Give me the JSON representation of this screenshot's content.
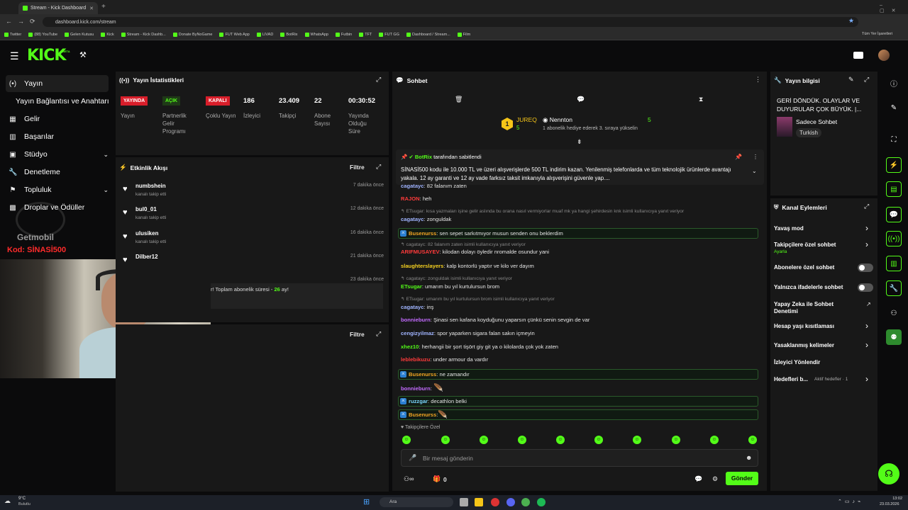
{
  "browser": {
    "tab_title": "Stream - Kick Dashboard",
    "url": "dashboard.kick.com/stream",
    "bookmarks": [
      "Twitter",
      "(88) YouTube",
      "Gelen Kutusu",
      "Kick",
      "Stream - Kick Dashb...",
      "Donate ByNoGame",
      "FUT Web App",
      "LIVAD",
      "BotRix",
      "WhatsApp",
      "Futbin",
      "TFT",
      "FUT GG",
      "Dashboard / Stream...",
      "Film"
    ],
    "all_bookmarks": "Tüm Yer İşaretleri"
  },
  "header": {
    "logo": "KICK",
    "beta": "BETA"
  },
  "sidebar": {
    "items": [
      {
        "label": "Yayın",
        "icon": "broadcast-icon"
      },
      {
        "label": "Yayın Bağlantısı ve Anahtarı",
        "icon": ""
      },
      {
        "label": "Gelir",
        "icon": "revenue-icon"
      },
      {
        "label": "Başarılar",
        "icon": "achievements-icon"
      },
      {
        "label": "Stüdyo",
        "icon": "studio-icon"
      },
      {
        "label": "Denetleme",
        "icon": "moderation-icon"
      },
      {
        "label": "Topluluk",
        "icon": "community-icon"
      },
      {
        "label": "Droplar ve Ödüller",
        "icon": "drops-icon"
      }
    ]
  },
  "overlay": {
    "brand": "Getmobil",
    "code": "Kod: SİNASİ500"
  },
  "stats": {
    "title": "Yayın İstatistikleri",
    "items": [
      {
        "badge": "YAYINDA",
        "label": "Yayın",
        "color": "#d81e2a"
      },
      {
        "badge": "AÇIK",
        "label": "Partnerlik Gelir Programı",
        "color": "#53fc18"
      },
      {
        "badge": "KAPALI",
        "label": "Çoklu Yayın",
        "color": "#d81e2a"
      },
      {
        "value": "186",
        "label": "İzleyici"
      },
      {
        "value": "23.409",
        "label": "Takipçi"
      },
      {
        "value": "22",
        "label": "Abone Sayısı"
      },
      {
        "value": "00:30:52",
        "label": "Yayında Olduğu Süre"
      }
    ]
  },
  "activity": {
    "title": "Etkinlik Akışı",
    "filter": "Filtre",
    "rows": [
      {
        "name": "numbshein",
        "sub": "kanalı takip etti",
        "time": "7 dakika önce"
      },
      {
        "name": "bul0_01",
        "sub": "kanalı takip etti",
        "time": "12 dakika önce"
      },
      {
        "name": "ulusiken",
        "sub": "kanalı takip etti",
        "time": "16 dakika önce"
      },
      {
        "name": "Dilber12",
        "sub": "",
        "time": "21 dakika önce"
      },
      {
        "name": "",
        "sub": "",
        "time": "23 dakika önce"
      }
    ],
    "sub_note": "r! Toplam abonelik süresi - ",
    "sub_months": "26",
    "sub_tail": " ay!"
  },
  "bottom_panel": {
    "filter": "Filtre"
  },
  "chat": {
    "title": "Sohbet",
    "leaders": [
      {
        "name": "JUREQ",
        "count": "5",
        "rank": "1"
      },
      {
        "name": "Nennton",
        "count": "5",
        "note": "1 abonelik hediye ederek 3. sıraya yükselin"
      }
    ],
    "pinned": {
      "by": "BotRix",
      "by_suffix": "tarafından sabitlendi",
      "text": "SİNASİ500 kodu ile 10.000 TL ve üzeri alışverişlerde 500 TL indirim kazan.  Yenilenmiş telefonlarda ve tüm teknolojik ürünlerde avantajı yakala. 12 ay garanti ve 12 ay vade farksız taksit imkanıyla alışverişini güvenle yap...."
    },
    "messages": [
      {
        "user": "cagatayc",
        "color": "#a0b4ff",
        "text": ": 82 falanım zaten"
      },
      {
        "user": "RAJON",
        "color": "#ff3b3b",
        "text": ": heh"
      },
      {
        "reply": "ETsugar: kısa yazmaları işine gelir aslında bu orana nasıl vermiyorlar muaf mk ya hangi şehirdesin knk isimli kullanıcıya yanıt veriyor"
      },
      {
        "user": "cagatayc",
        "color": "#a0b4ff",
        "text": ": zonguldak"
      },
      {
        "user": "Busenurss",
        "color": "#f5a623",
        "text": ": sen sepet sarkıtmıyor musun senden onu beklerdim",
        "hl": true
      },
      {
        "reply": "cagatayc: 82 falanım zaten isimli kullanıcıya yanıt veriyor"
      },
      {
        "user": "ARIFMUSAYEV",
        "color": "#ff3b3b",
        "text": ": kilodan dolayı öyledir nromalde osundur yani"
      },
      {
        "user": "slaughterslayers",
        "color": "#f5d020",
        "text": ": kalp kontorlü yaptır ve kilo ver dayım"
      },
      {
        "reply": "cagatayc: zonguldak isimli kullanıcıya yanıt veriyor"
      },
      {
        "user": "ETsugar",
        "color": "#53fc18",
        "text": ": umarım bu yıl kurtulursun brom"
      },
      {
        "reply": "ETsugar: umarım bu yıl kurtulursun brom isimli kullanıcıya yanıt veriyor"
      },
      {
        "user": "cagatayc",
        "color": "#a0b4ff",
        "text": ": inş"
      },
      {
        "user": "bonnieburn",
        "color": "#c36bff",
        "text": ": Şinasi sen kafana koyduğunu yaparsın çünkü senin sevgin de var"
      },
      {
        "user": "cengizyilmaz",
        "color": "#a0b4ff",
        "text": ": spor yaparken sigara falan sakın içmeyin"
      },
      {
        "user": "xhez10",
        "color": "#53fc18",
        "text": ": herhangii bir şort tişört giy git ya o kilolarda çok yok zaten"
      },
      {
        "user": "leblebikuzu",
        "color": "#ff3b3b",
        "text": ": under armour da vardır"
      },
      {
        "user": "Busenurss",
        "color": "#f5a623",
        "text": ": ne zamandır",
        "hl": true
      },
      {
        "user": "bonnieburn",
        "color": "#c36bff",
        "text": ": ",
        "emote": true
      },
      {
        "user": "ruzzgar",
        "color": "#7ad7ff",
        "text": ": decathlon belki",
        "hl": true
      },
      {
        "user": "Busenurss",
        "color": "#f5a623",
        "text": ": ",
        "emote": true,
        "hl": true
      }
    ],
    "followers_only": "Takipçilere Özel",
    "input_placeholder": "Bir mesaj gönderin",
    "points": "0",
    "send": "Gönder"
  },
  "stream_info": {
    "title": "Yayın bilgisi",
    "stream_title": "GERİ DÖNDÜK. OLAYLAR VE DUYURULAR ÇOK BÜYÜK. |...",
    "category": "Sadece Sohbet",
    "language": "Turkish"
  },
  "channel_actions": {
    "title": "Kanal Eylemleri",
    "items": [
      {
        "label": "Yavaş mod",
        "kind": "chevron"
      },
      {
        "label": "Takipçilere özel sohbet",
        "sub": "Ayarla",
        "kind": "chevron"
      },
      {
        "label": "Abonelere özel sohbet",
        "kind": "toggle"
      },
      {
        "label": "Yalnızca ifadelerle sohbet",
        "kind": "toggle"
      },
      {
        "label": "Yapay Zeka ile Sohbet Denetimi",
        "kind": "link"
      },
      {
        "label": "Hesap yaşı kısıtlaması",
        "kind": "chevron"
      },
      {
        "label": "Yasaklanmış kelimeler",
        "kind": "chevron"
      },
      {
        "label": "İzleyici Yönlendir",
        "kind": "none"
      },
      {
        "label": "Hedefleri b...",
        "sub": "Aktif hedefler · 1",
        "kind": "chevron"
      }
    ]
  },
  "taskbar": {
    "weather_temp": "9°C",
    "weather_desc": "Bulutlu",
    "search": "Ara",
    "time": "13:02",
    "date": "23.03.2026"
  }
}
